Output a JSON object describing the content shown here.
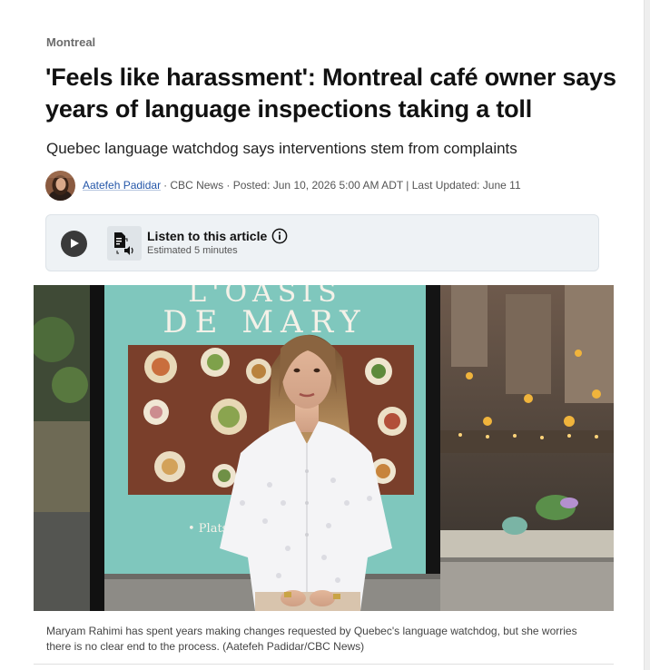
{
  "section": "Montreal",
  "headline": "'Feels like harassment': Montreal café owner says years of language inspections taking a toll",
  "deck": "Quebec language watchdog says interventions stem from complaints",
  "byline": {
    "author": "Aatefeh Padidar",
    "meta": "· CBC News · Posted: Jun 10, 2026 5:00 AM ADT | Last Updated: June 11"
  },
  "listen": {
    "title": "Listen to this article",
    "estimate": "Estimated 5 minutes"
  },
  "photo": {
    "storefront_line1": "L'OASIS",
    "storefront_line2": "DE MARY",
    "window_text": "• Plats l"
  },
  "caption": "Maryam Rahimi has spent years making changes requested by Quebec's language watchdog, but she worries there is no clear end to the process. (Aatefeh Padidar/CBC News)",
  "colors": {
    "link": "#2456a8",
    "listen_bg": "#eef2f5",
    "storefront_teal": "#7fc7bd"
  }
}
